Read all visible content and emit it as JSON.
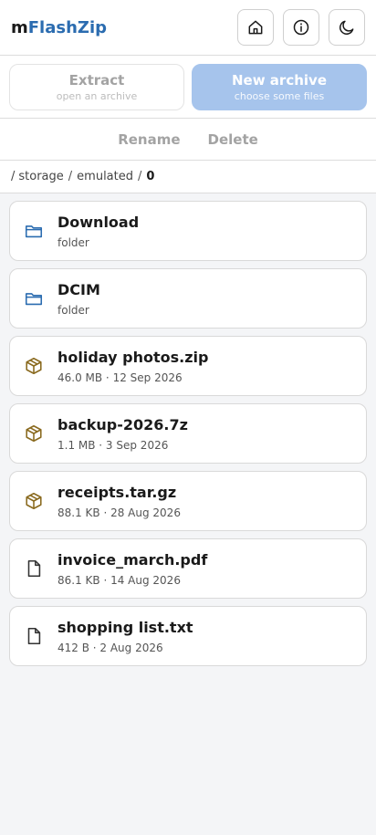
{
  "app": {
    "brand_prefix": "m",
    "brand_name": "FlashZip",
    "accent_color": "#2b6cb0",
    "header_icons": [
      "home-icon",
      "info-icon",
      "moon-icon"
    ]
  },
  "actions": {
    "extract": {
      "title": "Extract",
      "subtitle": "open an archive"
    },
    "new_archive": {
      "title": "New archive",
      "subtitle": "choose some files"
    },
    "rename": "Rename",
    "delete": "Delete"
  },
  "breadcrumb": {
    "leading_sep": "/",
    "segments": [
      "storage",
      "emulated"
    ],
    "separator": "/",
    "current": "0"
  },
  "files": [
    {
      "name": "Download",
      "meta": "folder",
      "icon": "folder-icon"
    },
    {
      "name": "DCIM",
      "meta": "folder",
      "icon": "folder-icon"
    },
    {
      "name": "holiday photos.zip",
      "meta": "46.0 MB · 12 Sep 2026",
      "icon": "archive-icon"
    },
    {
      "name": "backup-2026.7z",
      "meta": "1.1 MB · 3 Sep 2026",
      "icon": "archive-icon"
    },
    {
      "name": "receipts.tar.gz",
      "meta": "88.1 KB · 28 Aug 2026",
      "icon": "archive-icon"
    },
    {
      "name": "invoice_march.pdf",
      "meta": "86.1 KB · 14 Aug 2026",
      "icon": "file-icon"
    },
    {
      "name": "shopping list.txt",
      "meta": "412 B · 2 Aug 2026",
      "icon": "file-icon"
    }
  ]
}
